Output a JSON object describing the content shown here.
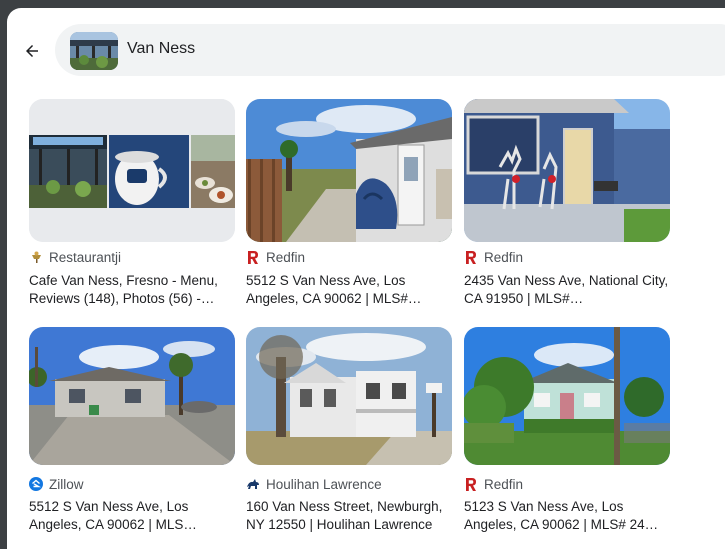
{
  "search": {
    "query": "Van Ness"
  },
  "icons": {
    "back": "arrow-left-icon"
  },
  "colors": {
    "redfin": "#c82021",
    "zillow": "#1277e1",
    "houlihan": "#1a3a6b"
  },
  "results": [
    {
      "source": "Restaurantji",
      "title": "Cafe Van Ness, Fresno - Menu, Reviews (148), Photos (56) -…"
    },
    {
      "source": "Redfin",
      "title": "5512 S Van Ness Ave, Los Angeles, CA 90062 | MLS#…"
    },
    {
      "source": "Redfin",
      "title": "2435 Van Ness Ave, National City, CA 91950 | MLS#…"
    },
    {
      "source": "Zillow",
      "title": "5512 S Van Ness Ave, Los Angeles, CA 90062 | MLS…"
    },
    {
      "source": "Houlihan Lawrence",
      "title": "160 Van Ness Street, Newburgh, NY 12550 | Houlihan Lawrence"
    },
    {
      "source": "Redfin",
      "title": "5123 S Van Ness Ave, Los Angeles, CA 90062 | MLS# 24…"
    }
  ]
}
